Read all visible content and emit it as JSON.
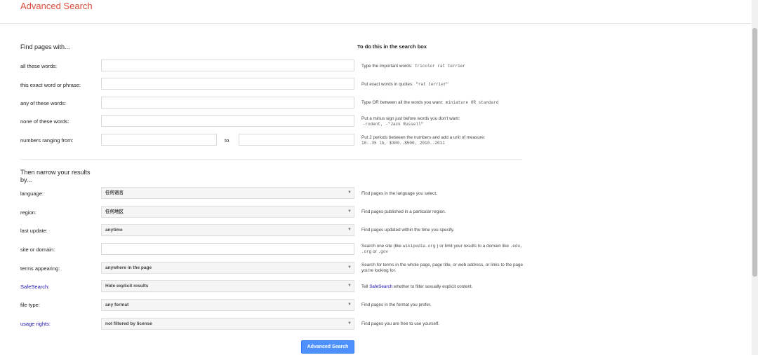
{
  "header": {
    "title": "Advanced Search"
  },
  "find_section": {
    "heading": "Find pages with...",
    "right_heading": "To do this in the search box",
    "rows": [
      {
        "label": "all these words:",
        "help_text": "Type the important words:",
        "help_code": "tricolor rat terrier"
      },
      {
        "label": "this exact word or phrase:",
        "help_text": "Put exact words in quotes:",
        "help_code": "\"rat terrier\""
      },
      {
        "label": "any of these words:",
        "help_text": "Type OR between all the words you want:",
        "help_code": "miniature OR standard"
      },
      {
        "label": "none of these words:",
        "help_text": "Put a minus sign just before words you don't want:",
        "help_code": "-rodent, -\"Jack Russell\""
      },
      {
        "label": "numbers ranging from:",
        "to_label": "to",
        "help_text": "Put 2 periods between the numbers and add a unit of measure:",
        "help_code": "10..35 lb, $300..$500, 2010..2011"
      }
    ]
  },
  "narrow_section": {
    "heading_line1": "Then narrow your results",
    "heading_line2": "by...",
    "rows": [
      {
        "label": "language:",
        "value": "任何语言",
        "help": "Find pages in the language you select."
      },
      {
        "label": "region:",
        "value": "任何地区",
        "help": "Find pages published in a particular region."
      },
      {
        "label": "last update:",
        "value": "anytime",
        "help": "Find pages updated within the time you specify."
      },
      {
        "label": "site or domain:",
        "help_a": "Search one site (like",
        "help_code_a": "wikipedia.org",
        "help_b": ") or limit your results to a domain like",
        "help_code_b": ".edu, .org",
        "help_c": "or",
        "help_code_c": ".gov"
      },
      {
        "label": "terms appearing:",
        "value": "anywhere in the page",
        "help": "Search for terms in the whole page, page title, or web address, or links to the page you're looking for."
      },
      {
        "label": "SafeSearch:",
        "value": "Hide explicit results",
        "help_a": "Tell",
        "help_link": "SafeSearch",
        "help_b": "whether to filter sexually explicit content."
      },
      {
        "label": "file type:",
        "value": "any format",
        "help": "Find pages in the format you prefer."
      },
      {
        "label": "usage rights:",
        "value": "not filtered by license",
        "help": "Find pages you are free to use yourself."
      }
    ]
  },
  "submit": {
    "label": "Advanced Search"
  },
  "colors": {
    "title": "#dd4b39",
    "link": "#1a0dab",
    "button": "#4d90fe"
  }
}
